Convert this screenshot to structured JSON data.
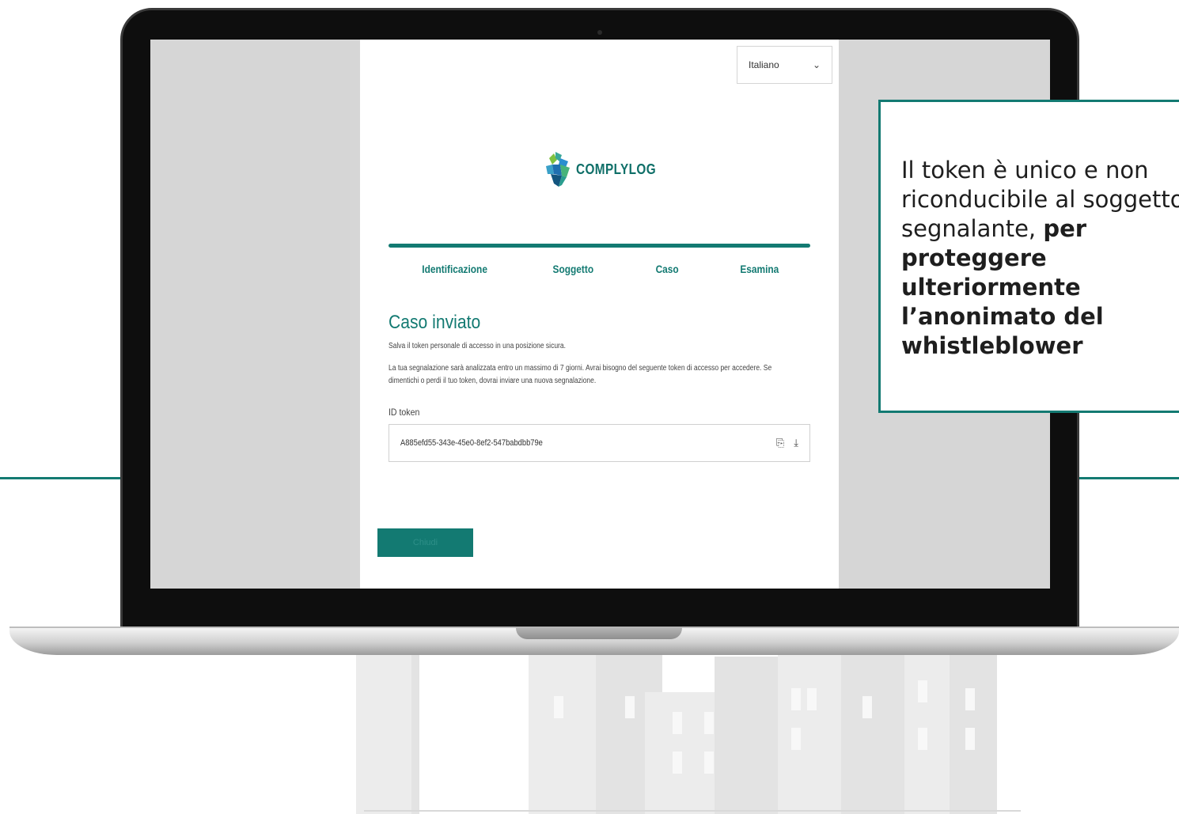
{
  "language_select": {
    "value": "Italiano"
  },
  "brand": {
    "name": "COMPLYLOG"
  },
  "steps": [
    "Identificazione",
    "Soggetto",
    "Caso",
    "Esamina"
  ],
  "confirmation": {
    "title": "Caso inviato",
    "instruction": "Salva il token personale di accesso in una posizione sicura.",
    "description": "La tua segnalazione sarà analizzata entro un massimo di 7 giorni. Avrai bisogno del seguente token di accesso per accedere. Se dimentichi o perdi il tuo token, dovrai inviare una nuova segnalazione.",
    "token_label": "ID token",
    "token_value": "A885efd55-343e-45e0-8ef2-547babdbb79e"
  },
  "close_button": {
    "label": "Chiudi"
  },
  "callout": {
    "text_normal": "Il token è unico e non riconducibile al soggetto segnalante, ",
    "text_bold": "per proteggere ulteriormente l’anonimato del whistleblower"
  },
  "colors": {
    "accent": "#137a72"
  }
}
